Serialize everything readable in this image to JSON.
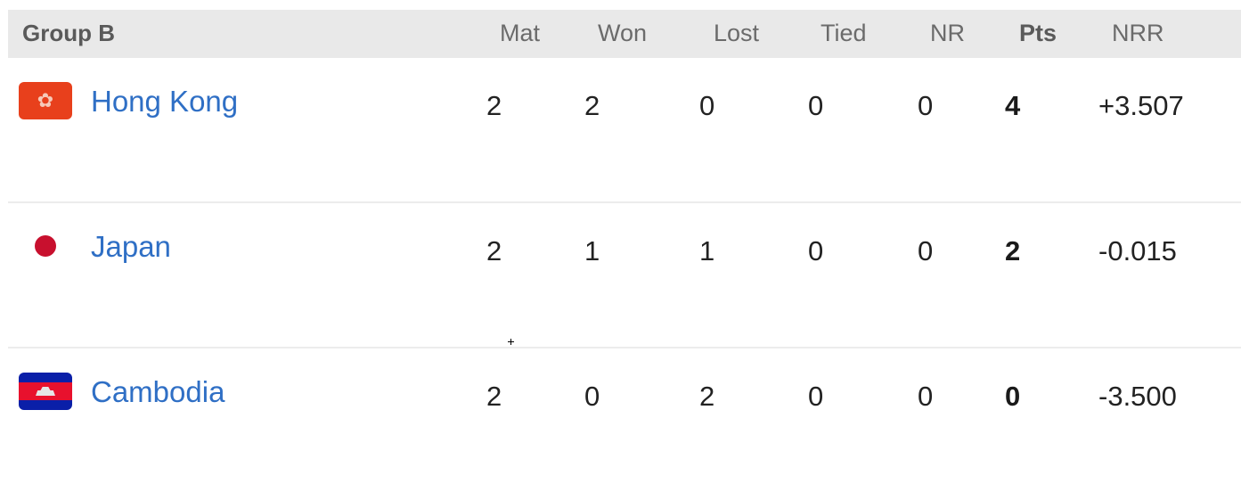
{
  "table": {
    "group_title": "Group B",
    "columns": {
      "mat": "Mat",
      "won": "Won",
      "lost": "Lost",
      "tied": "Tied",
      "nr": "NR",
      "pts": "Pts",
      "nrr": "NRR"
    },
    "rows": [
      {
        "team": "Hong Kong",
        "flag_icon": "hong-kong-flag-icon",
        "mat": "2",
        "won": "2",
        "lost": "0",
        "tied": "0",
        "nr": "0",
        "pts": "4",
        "nrr": "+3.507"
      },
      {
        "team": "Japan",
        "flag_icon": "japan-flag-icon",
        "mat": "2",
        "won": "1",
        "lost": "1",
        "tied": "0",
        "nr": "0",
        "pts": "2",
        "nrr": "-0.015"
      },
      {
        "team": "Cambodia",
        "flag_icon": "cambodia-flag-icon",
        "mat": "2",
        "won": "0",
        "lost": "2",
        "tied": "0",
        "nr": "0",
        "pts": "0",
        "nrr": "-3.500"
      }
    ]
  },
  "colors": {
    "header_bg": "#e9e9e9",
    "team_link": "#2f6fc5",
    "divider": "#ececec"
  }
}
